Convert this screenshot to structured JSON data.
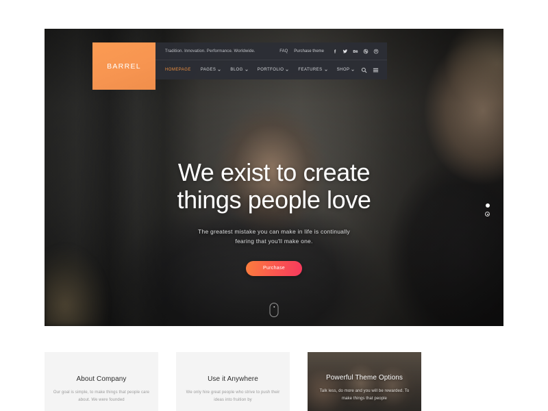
{
  "site": {
    "logo": "BARREL",
    "accent_orange": "#F79551",
    "header_bg": "#2C2E35"
  },
  "topbar": {
    "tagline": "Tradition. Innovation. Performance. Worldwide.",
    "links": [
      {
        "label": "FAQ"
      },
      {
        "label": "Purchase theme"
      }
    ],
    "socials": [
      {
        "name": "facebook-icon"
      },
      {
        "name": "twitter-icon"
      },
      {
        "name": "behance-icon"
      },
      {
        "name": "dribbble-icon"
      },
      {
        "name": "pinterest-icon"
      }
    ]
  },
  "nav": {
    "items": [
      {
        "label": "Homepage",
        "active": true,
        "has_dropdown": false
      },
      {
        "label": "Pages",
        "active": false,
        "has_dropdown": true
      },
      {
        "label": "Blog",
        "active": false,
        "has_dropdown": true
      },
      {
        "label": "Portfolio",
        "active": false,
        "has_dropdown": true
      },
      {
        "label": "Features",
        "active": false,
        "has_dropdown": true
      },
      {
        "label": "Shop",
        "active": false,
        "has_dropdown": true
      }
    ],
    "tools": [
      {
        "name": "search-icon"
      },
      {
        "name": "hamburger-menu-icon"
      }
    ]
  },
  "hero": {
    "title_line1": "We exist to create",
    "title_line2": "things people love",
    "subtitle_line1": "The greatest mistake you can make in life is continually",
    "subtitle_line2": "fearing that you'll make one.",
    "cta_label": "Purchase",
    "slides": [
      {
        "index": 1,
        "active": true
      },
      {
        "index": 2,
        "active": false
      }
    ]
  },
  "cards": [
    {
      "title": "About Company",
      "text": "Our goal is simple, to make things that people care about. We were founded",
      "style": "plain"
    },
    {
      "title": "Use it Anywhere",
      "text": "We only hire great people who strive to push their ideas into fruition by",
      "style": "plain"
    },
    {
      "title": "Powerful Theme Options",
      "text": "Talk less, do more and you will be rewarded. To make things that people",
      "style": "photo"
    }
  ]
}
